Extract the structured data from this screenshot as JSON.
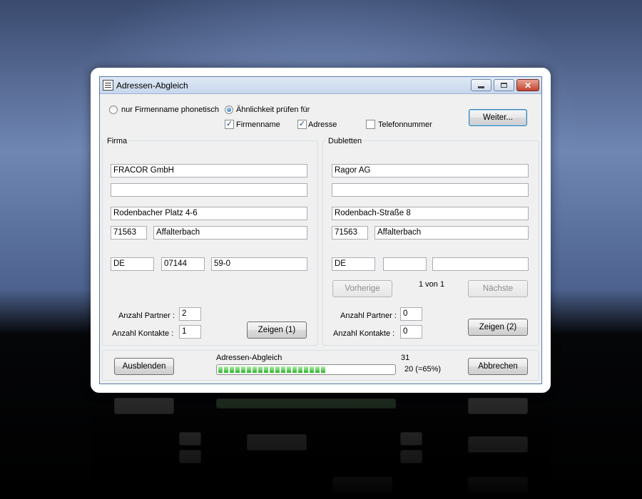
{
  "window": {
    "title": "Adressen-Abgleich",
    "controls": [
      "minimize-icon",
      "maximize-icon",
      "close-icon"
    ],
    "close_glyph": "✕"
  },
  "options": {
    "radio_phonetic": "nur Firmenname phonetisch",
    "radio_similarity": "Ähnlichkeit prüfen für",
    "selected_radio": "radio_similarity",
    "check_firmenname": {
      "label": "Firmenname",
      "checked": true
    },
    "check_adresse": {
      "label": "Adresse",
      "checked": true
    },
    "check_telefon": {
      "label": "Telefonnummer",
      "checked": false
    },
    "next_button": "Weiter..."
  },
  "firma": {
    "group_title": "Firma",
    "name1": "FRACOR GmbH",
    "name2": "",
    "street": "Rodenbacher Platz 4-6",
    "zip": "71563",
    "city": "Affalterbach",
    "country": "DE",
    "area_code": "07144",
    "phone": "59-0",
    "partner_label": "Anzahl Partner :",
    "partner_count": "2",
    "contacts_label": "Anzahl Kontakte :",
    "contacts_count": "1",
    "show_button": "Zeigen (1)"
  },
  "dubletten": {
    "group_title": "Dubletten",
    "name1": "Ragor AG",
    "name2": "",
    "street": "Rodenbach-Straße 8",
    "zip": "71563",
    "city": "Affalterbach",
    "country": "DE",
    "area_code": "",
    "phone": "",
    "prev_button": "Vorherige",
    "pager": "1 von 1",
    "next_button": "Nächste",
    "partner_label": "Anzahl Partner :",
    "partner_count": "0",
    "contacts_label": "Anzahl Kontakte :",
    "contacts_count": "0",
    "show_button": "Zeigen (2)"
  },
  "footer": {
    "hide_button": "Ausblenden",
    "progress_label": "Adressen-Abgleich",
    "total": "31",
    "progress_text": "20 (=65%)",
    "progress_fraction": 0.65,
    "cancel_button": "Abbrechen"
  },
  "colors": {
    "accent": "#3c7fb1",
    "progress_green": "#28b428",
    "close_red": "#c2432d"
  }
}
